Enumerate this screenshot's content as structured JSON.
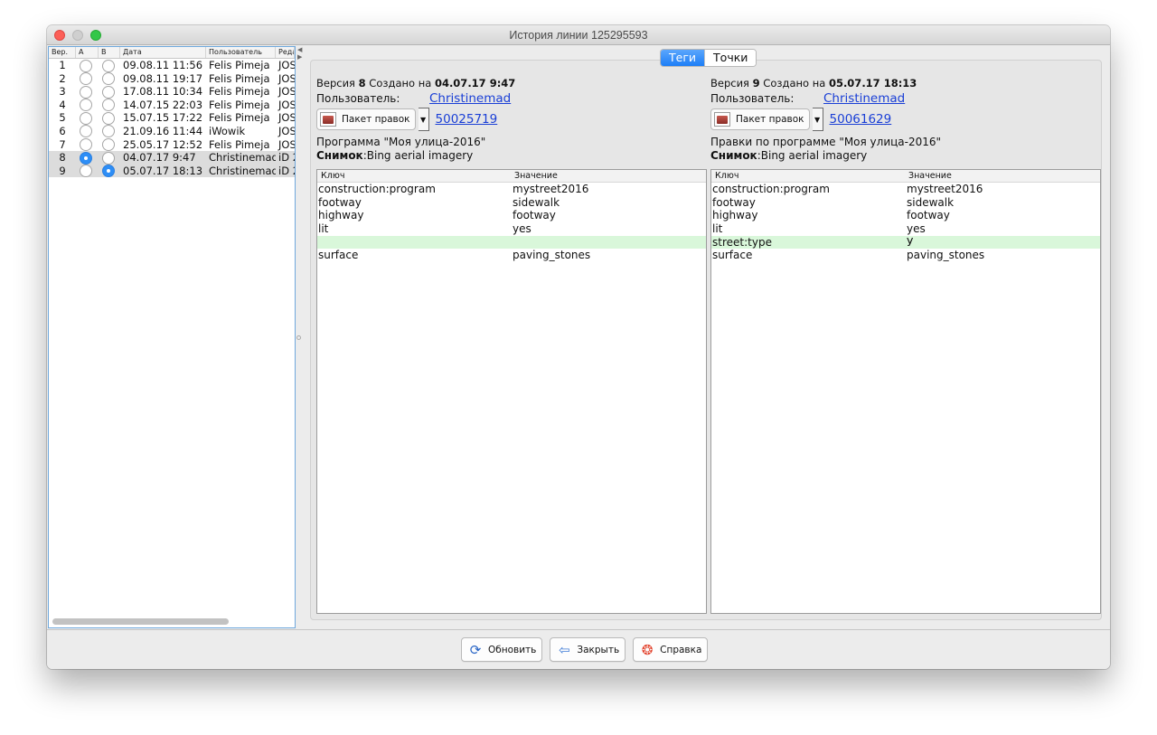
{
  "window": {
    "title": "История линии 125295593"
  },
  "history": {
    "headers": {
      "ver": "Вер.",
      "a": "A",
      "b": "B",
      "date": "Дата",
      "user": "Пользователь",
      "editor": "Реда"
    },
    "rows": [
      {
        "ver": "1",
        "date": "09.08.11 11:56",
        "user": "Felis Pimeja",
        "editor": "JOS",
        "a_selected": false,
        "b_selected": false
      },
      {
        "ver": "2",
        "date": "09.08.11 19:17",
        "user": "Felis Pimeja",
        "editor": "JOS",
        "a_selected": false,
        "b_selected": false
      },
      {
        "ver": "3",
        "date": "17.08.11 10:34",
        "user": "Felis Pimeja",
        "editor": "JOS",
        "a_selected": false,
        "b_selected": false
      },
      {
        "ver": "4",
        "date": "14.07.15 22:03",
        "user": "Felis Pimeja",
        "editor": "JOS",
        "a_selected": false,
        "b_selected": false
      },
      {
        "ver": "5",
        "date": "15.07.15 17:22",
        "user": "Felis Pimeja",
        "editor": "JOS",
        "a_selected": false,
        "b_selected": false
      },
      {
        "ver": "6",
        "date": "21.09.16 11:44",
        "user": "iWowik",
        "editor": "JOS",
        "a_selected": false,
        "b_selected": false
      },
      {
        "ver": "7",
        "date": "25.05.17 12:52",
        "user": "Felis Pimeja",
        "editor": "JOS",
        "a_selected": false,
        "b_selected": false
      },
      {
        "ver": "8",
        "date": "04.07.17 9:47",
        "user": "Christinemad",
        "editor": "iD 2",
        "a_selected": true,
        "b_selected": false
      },
      {
        "ver": "9",
        "date": "05.07.17 18:13",
        "user": "Christinemad",
        "editor": "iD 2",
        "a_selected": false,
        "b_selected": true
      }
    ]
  },
  "tabs": {
    "tags": "Теги",
    "nodes": "Точки"
  },
  "left_version": {
    "prefix": "Версия ",
    "number": "8",
    "created_on": " Создано на ",
    "datetime": "04.07.17 9:47",
    "user_label": "Пользователь:",
    "user": "Christinemad",
    "changeset_button": "Пакет правок",
    "changeset_id": "50025719",
    "comment": "Программа \"Моя улица-2016\"",
    "source_label": "Снимок",
    "source": ":Bing aerial imagery"
  },
  "right_version": {
    "prefix": "Версия ",
    "number": "9",
    "created_on": " Создано на ",
    "datetime": "05.07.17 18:13",
    "user_label": "Пользователь:",
    "user": "Christinemad",
    "changeset_button": "Пакет правок",
    "changeset_id": "50061629",
    "comment": "Правки по программе \"Моя улица-2016\"",
    "source_label": "Снимок",
    "source": ":Bing aerial imagery"
  },
  "tag_table": {
    "key_header": "Ключ",
    "value_header": "Значение",
    "left_rows": [
      {
        "key": "construction:program",
        "value": "mystreet2016",
        "added": false
      },
      {
        "key": "footway",
        "value": "sidewalk",
        "added": false
      },
      {
        "key": "highway",
        "value": "footway",
        "added": false
      },
      {
        "key": "lit",
        "value": "yes",
        "added": false
      },
      {
        "key": "",
        "value": "",
        "added": true
      },
      {
        "key": "surface",
        "value": "paving_stones",
        "added": false
      }
    ],
    "right_rows": [
      {
        "key": "construction:program",
        "value": "mystreet2016",
        "added": false
      },
      {
        "key": "footway",
        "value": "sidewalk",
        "added": false
      },
      {
        "key": "highway",
        "value": "footway",
        "added": false
      },
      {
        "key": "lit",
        "value": "yes",
        "added": false
      },
      {
        "key": "street:type",
        "value": "У",
        "added": true
      },
      {
        "key": "surface",
        "value": "paving_stones",
        "added": false
      }
    ],
    "added_color": "#d9f7da"
  },
  "buttons": {
    "refresh": "Обновить",
    "close": "Закрыть",
    "help": "Справка"
  },
  "icons": {
    "refresh": "refresh-icon",
    "close": "close-arrow-icon",
    "help": "lifebuoy-icon",
    "changeset": "changeset-icon"
  }
}
